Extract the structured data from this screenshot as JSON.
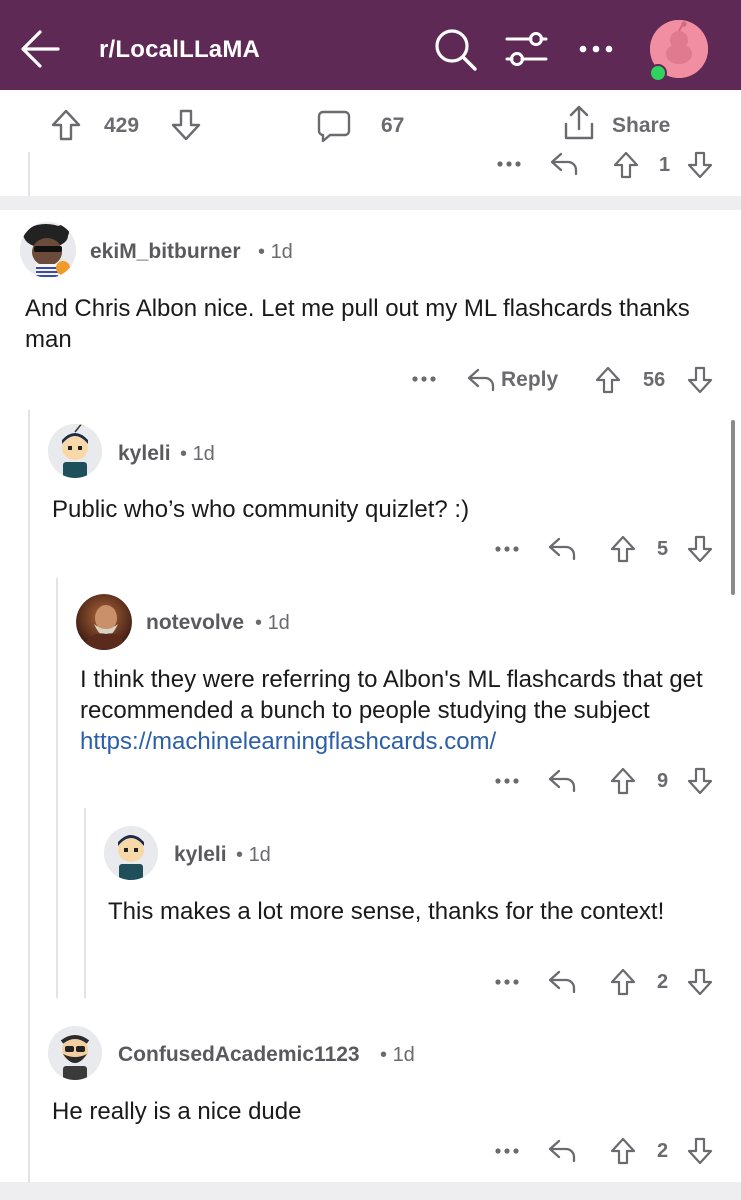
{
  "header": {
    "subreddit": "r/LocalLLaMA",
    "back_icon": "arrow-left-icon",
    "search_icon": "search-icon",
    "filter_icon": "sliders-icon",
    "more_icon": "more-horizontal-icon",
    "avatar_icon": "user-avatar-icon",
    "bg_color": "#5e2a55"
  },
  "post_bar": {
    "upvotes": "429",
    "comments": "67",
    "share_label": "Share"
  },
  "previous_comment": {
    "score": "1"
  },
  "comments": [
    {
      "author": "ekiM_bitburner",
      "age": "1d",
      "body": "And Chris Albon nice. Let me pull out my ML flashcards thanks man",
      "reply_label": "Reply",
      "score": "56"
    },
    {
      "author": "kyleli",
      "age": "1d",
      "body": "Public who’s who community quizlet? :)",
      "score": "5"
    },
    {
      "author": "notevolve",
      "age": "1d",
      "body": "I think they were referring to Albon's ML flashcards that get recommended a bunch to people studying the subject",
      "link": "https://machinelearningflashcards.com/",
      "score": "9"
    },
    {
      "author": "kyleli",
      "age": "1d",
      "body": "This makes a lot more sense, thanks for the context!",
      "score": "2"
    },
    {
      "author": "ConfusedAcademic1123",
      "age": "1d",
      "body": "He really is a nice dude",
      "score": "2"
    }
  ],
  "colors": {
    "accent_link": "#2c5fa8",
    "meta_gray": "#6b6b6f",
    "thread_line": "#e3e3e6"
  }
}
